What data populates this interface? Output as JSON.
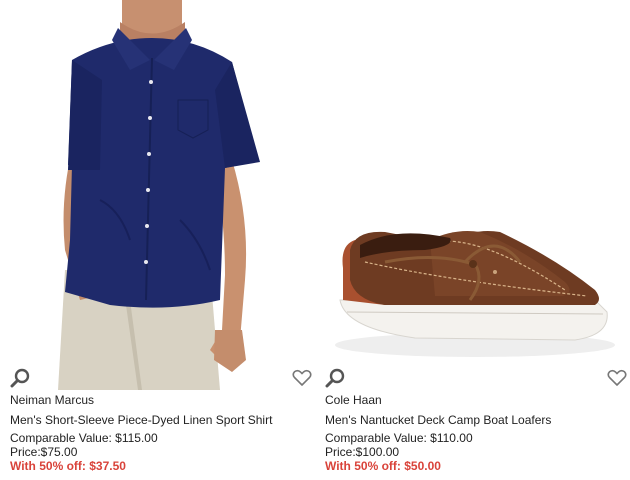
{
  "products": [
    {
      "brand": "Neiman Marcus",
      "title": "Men's Short-Sleeve Piece-Dyed Linen Sport Shirt",
      "comparable": "Comparable Value: $115.00",
      "price": "Price:$75.00",
      "sale": "With 50% off: $37.50",
      "image_icon": "shirt-product-image",
      "zoom_icon": "magnifier-icon",
      "fav_icon": "heart-outline-icon"
    },
    {
      "brand": "Cole Haan",
      "title": "Men's Nantucket Deck Camp Boat Loafers",
      "comparable": "Comparable Value: $110.00",
      "price": "Price:$100.00",
      "sale": "With 50% off: $50.00",
      "image_icon": "loafer-product-image",
      "zoom_icon": "magnifier-icon",
      "fav_icon": "heart-outline-icon"
    }
  ],
  "colors": {
    "sale_red": "#d9433a",
    "shirt_navy": "#1f2a6b",
    "pants_khaki": "#d8d2c3",
    "shoe_brown": "#6e3b22",
    "icon_gray": "#555555"
  }
}
